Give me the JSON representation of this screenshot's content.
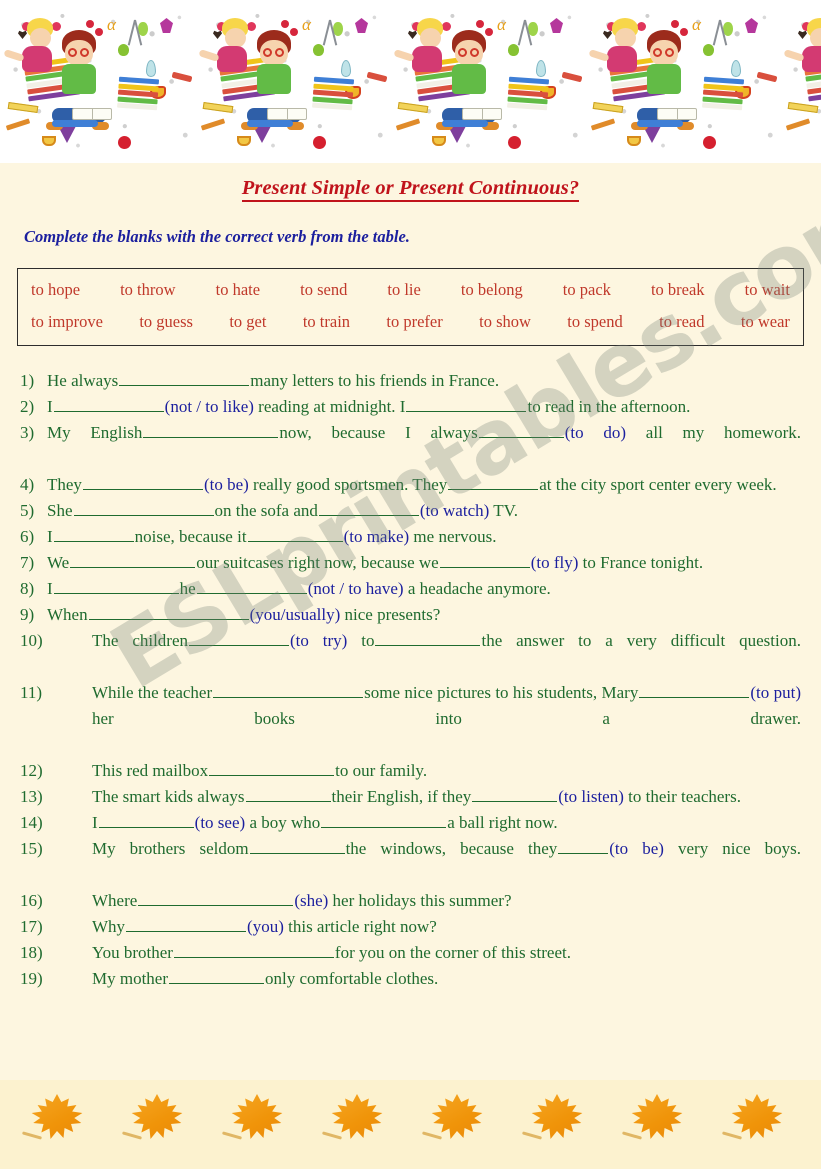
{
  "worksheet": {
    "title": "Present Simple or Present Continuous?",
    "instruction": "Complete the blanks with the correct verb from the table.",
    "watermark": "ESLprintables.com"
  },
  "verb_table": {
    "row1": [
      "to hope",
      "to throw",
      "to hate",
      "to send",
      "to lie",
      "to belong",
      "to pack",
      "to break",
      "to wait"
    ],
    "row2": [
      "to improve",
      "to guess",
      "to get",
      "to train",
      "to prefer",
      "to show",
      "to spend",
      "to read",
      "to wear"
    ]
  },
  "exercises": [
    {
      "number": "1)",
      "parts": [
        {
          "t": "He always"
        },
        {
          "b": 130
        },
        {
          "t": "many letters to his friends in France."
        }
      ]
    },
    {
      "number": "2)",
      "parts": [
        {
          "t": "I"
        },
        {
          "b": 110
        },
        {
          "h": "(not / to like)"
        },
        {
          "t": " reading at midnight. I"
        },
        {
          "b": 120
        },
        {
          "t": "to read in the afternoon."
        }
      ]
    },
    {
      "number": "3)",
      "justify": true,
      "parts": [
        {
          "t": "My  English"
        },
        {
          "b": 135
        },
        {
          "t": "now,  because  I  always"
        },
        {
          "b": 85
        },
        {
          "h": "(to  do)"
        },
        {
          "t": " all my homework."
        }
      ]
    },
    {
      "number": "4)",
      "parts": [
        {
          "t": "They"
        },
        {
          "b": 120
        },
        {
          "h": "(to be)"
        },
        {
          "t": " really good sportsmen. They"
        },
        {
          "b": 90
        },
        {
          "t": "at the city sport center every week."
        }
      ]
    },
    {
      "number": "5)",
      "parts": [
        {
          "t": "She"
        },
        {
          "b": 140
        },
        {
          "t": "on the sofa and"
        },
        {
          "b": 100
        },
        {
          "h": "(to watch)"
        },
        {
          "t": " TV."
        }
      ]
    },
    {
      "number": "6)",
      "parts": [
        {
          "t": "I"
        },
        {
          "b": 80
        },
        {
          "t": "noise, because it"
        },
        {
          "b": 95
        },
        {
          "h": "(to make)"
        },
        {
          "t": " me nervous."
        }
      ]
    },
    {
      "number": "7)",
      "parts": [
        {
          "t": "We"
        },
        {
          "b": 125
        },
        {
          "t": "our  suitcases  right  now,  because  we"
        },
        {
          "b": 90
        },
        {
          "h": "(to fly)"
        },
        {
          "t": " to France tonight."
        }
      ]
    },
    {
      "number": "8)",
      "parts": [
        {
          "t": "I"
        },
        {
          "b": 125
        },
        {
          "t": "he"
        },
        {
          "b": 110
        },
        {
          "h": "(not / to have)"
        },
        {
          "t": " a headache anymore."
        }
      ]
    },
    {
      "number": "9)",
      "parts": [
        {
          "t": "When"
        },
        {
          "b": 160
        },
        {
          "h": "(you/usually)"
        },
        {
          "t": " nice presents?"
        }
      ]
    },
    {
      "number": "10)",
      "justify": true,
      "parts": [
        {
          "t": "The children"
        },
        {
          "b": 100
        },
        {
          "h": "(to try)"
        },
        {
          "t": " to"
        },
        {
          "b": 105
        },
        {
          "t": "the answer to a very difficult question."
        }
      ]
    },
    {
      "number": "11)",
      "justify": true,
      "parts": [
        {
          "t": "While  the  teacher"
        },
        {
          "b": 150
        },
        {
          "t": "some  nice  pictures  to  his students, Mary"
        },
        {
          "b": 110
        },
        {
          "h": "(to put)"
        },
        {
          "t": " her books into a drawer."
        }
      ]
    },
    {
      "number": "12)",
      "parts": [
        {
          "t": "This red mailbox"
        },
        {
          "b": 125
        },
        {
          "t": "to our family."
        }
      ]
    },
    {
      "number": "13)",
      "parts": [
        {
          "t": "The smart kids always"
        },
        {
          "b": 85
        },
        {
          "t": "their English, if they"
        },
        {
          "b": 85
        },
        {
          "h": "(to listen)"
        },
        {
          "t": " to their teachers."
        }
      ]
    },
    {
      "number": "14)",
      "parts": [
        {
          "t": "I"
        },
        {
          "b": 95
        },
        {
          "h": "(to see)"
        },
        {
          "t": " a boy who"
        },
        {
          "b": 125
        },
        {
          "t": "a ball right now."
        }
      ]
    },
    {
      "number": "15)",
      "justify": true,
      "parts": [
        {
          "t": "My  brothers  seldom"
        },
        {
          "b": 95
        },
        {
          "t": "the  windows,  because  they"
        },
        {
          "b": 50
        },
        {
          "h": "(to be)"
        },
        {
          "t": " very nice boys."
        }
      ]
    },
    {
      "number": "16)",
      "parts": [
        {
          "t": "Where"
        },
        {
          "b": 155
        },
        {
          "h": "(she)"
        },
        {
          "t": " her holidays this summer?"
        }
      ]
    },
    {
      "number": "17)",
      "parts": [
        {
          "t": "Why"
        },
        {
          "b": 120
        },
        {
          "h": "(you)"
        },
        {
          "t": " this article right now?"
        }
      ]
    },
    {
      "number": "18)",
      "parts": [
        {
          "t": "You brother"
        },
        {
          "b": 160
        },
        {
          "t": "for you on the corner of this street."
        }
      ]
    },
    {
      "number": "19)",
      "parts": [
        {
          "t": "My mother"
        },
        {
          "b": 95
        },
        {
          "t": "only comfortable clothes."
        }
      ]
    }
  ],
  "decor": {
    "top_band": "school-kids-illustration-band",
    "bottom_band": "autumn-maple-leaf-band",
    "leaf_count": 8,
    "illustration_tiles": 5
  },
  "colors": {
    "page_background": "#fdf6e0",
    "title": "#c0131b",
    "instruction": "#1b1f9e",
    "verbs": "#c0392b",
    "sentences": "#1f6b2f",
    "hints": "#1b1f9e",
    "bottom_band": "#fcf2cf"
  }
}
